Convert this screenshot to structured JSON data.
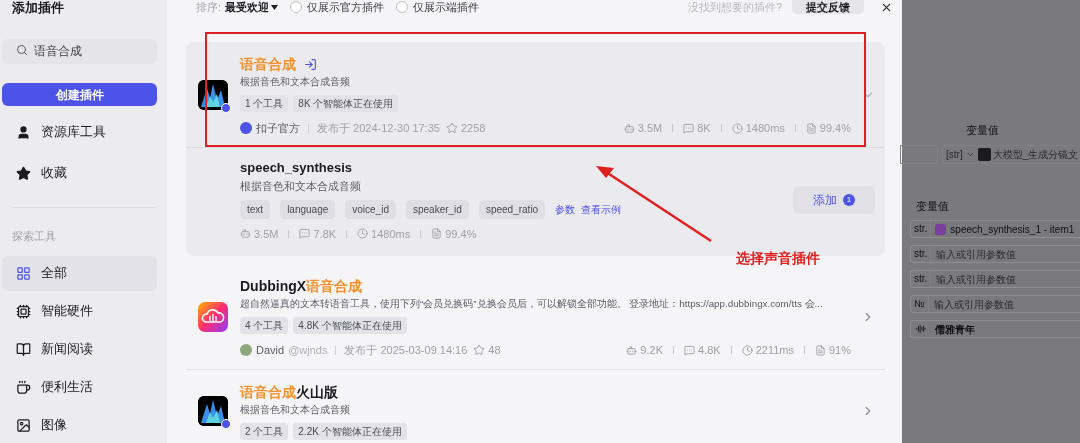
{
  "dialog": {
    "title": "添加插件"
  },
  "sidebar": {
    "search": {
      "value": "语音合成"
    },
    "create_button": "创建插件",
    "items": [
      {
        "label": "资源库工具"
      },
      {
        "label": "收藏"
      }
    ],
    "section_label": "探索工具",
    "categories": [
      {
        "label": "全部",
        "selected": true
      },
      {
        "label": "智能硬件",
        "selected": false
      },
      {
        "label": "新闻阅读",
        "selected": false
      },
      {
        "label": "便利生活",
        "selected": false
      },
      {
        "label": "图像",
        "selected": false
      }
    ]
  },
  "filters": {
    "sort_label": "排序:",
    "sort_value": "最受欢迎",
    "options": [
      {
        "label": "仅展示官方插件",
        "checked": false
      },
      {
        "label": "仅展示端插件",
        "checked": false
      }
    ],
    "hint": "没找到想要的插件?",
    "feedback_button": "提交反馈"
  },
  "plugins": [
    {
      "title": [
        {
          "text": "语音合成",
          "highlight": true
        }
      ],
      "link_icon": true,
      "description": "根据音色和文本合成音频",
      "kind": "official",
      "badges": [
        "1 个工具",
        "8K 个智能体正在使用"
      ],
      "author": "扣子官方",
      "published": "发布于 2024-12-30 17:35",
      "favorites": "2258",
      "stats": [
        "3.5M",
        "8K",
        "1480ms",
        "99.4%"
      ],
      "expanded": true,
      "tools": [
        {
          "name": "speech_synthesis",
          "description": "根据音色和文本合成音频",
          "params": [
            "text",
            "language",
            "voice_id",
            "speaker_id",
            "speed_ratio"
          ],
          "params_link": "参数",
          "example_link": "查看示例",
          "stats": [
            "3.5M",
            "7.8K",
            "1480ms",
            "99.4%"
          ],
          "add_button": "添加",
          "add_count": "1"
        }
      ]
    },
    {
      "title": [
        {
          "text": "DubbingX",
          "highlight": false
        },
        {
          "text": "语音合成",
          "highlight": true
        }
      ],
      "link_icon": false,
      "description": "超自然逼真的文本转语音工具，使用下列“会员兑换码”兑换会员后，可以解锁全部功能。 登录地址：https://app.dubbingx.com/tts 会...",
      "kind": "community",
      "badges": [
        "4 个工具",
        "4.8K 个智能体正在使用"
      ],
      "author": "David",
      "handle": "@wjnds",
      "published": "发布于 2025-03-09 14:16",
      "favorites": "48",
      "stats": [
        "9.2K",
        "4.8K",
        "2211ms",
        "91%"
      ],
      "expanded": false
    },
    {
      "title": [
        {
          "text": "语音合成",
          "highlight": true
        },
        {
          "text": "火山版",
          "highlight": false
        }
      ],
      "link_icon": false,
      "description": "根据音色和文本合成音频",
      "kind": "official",
      "badges": [
        "2 个工具",
        "2.2K 个智能体正在使用"
      ],
      "expanded": false
    }
  ],
  "background_panel": {
    "label_1": "变量值",
    "row_1": {
      "type": "[str]",
      "value": "大模型_生成分镜文"
    },
    "label_2": "变量值",
    "inputs": [
      {
        "kind": "ref",
        "type": "str.",
        "value": "speech_synthesis_1 - item1"
      },
      {
        "kind": "text",
        "type": "str.",
        "placeholder": "输入或引用参数值"
      },
      {
        "kind": "text",
        "type": "str.",
        "placeholder": "输入或引用参数值"
      },
      {
        "kind": "text",
        "type": "№",
        "placeholder": "输入或引用参数值"
      },
      {
        "kind": "voice",
        "value": "儒雅青年"
      }
    ]
  },
  "annotation": {
    "text": "选择声音插件"
  }
}
